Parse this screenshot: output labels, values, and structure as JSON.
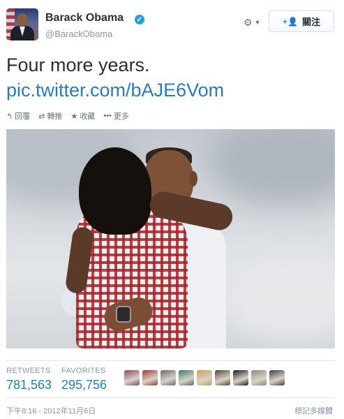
{
  "user": {
    "name": "Barack Obama",
    "handle": "@BarackObama",
    "verified_icon": "verified-check-icon"
  },
  "header": {
    "settings_icon": "gear-icon",
    "follow_button": {
      "icon": "add-user-icon",
      "label": "關注"
    }
  },
  "tweet": {
    "text": "Four more years.",
    "link": "pic.twitter.com/bAJE6Vom"
  },
  "actions": [
    {
      "icon": "reply-icon",
      "label": "回覆"
    },
    {
      "icon": "retweet-icon",
      "label": "轉推"
    },
    {
      "icon": "star-icon",
      "label": "收藏"
    },
    {
      "icon": "more-icon",
      "label": "更多"
    }
  ],
  "stats": {
    "retweets_label": "RETWEETS",
    "retweets_value": "781,563",
    "favorites_label": "FAVORITES",
    "favorites_value": "295,756"
  },
  "favoriters": {
    "count": 9,
    "colors": [
      "#8a4a6a",
      "#9a3b2e",
      "#6b6b6b",
      "#3f7a6a",
      "#c8a452",
      "#5a4530",
      "#1d1d1d",
      "#8d8a78",
      "#4a3d3a"
    ]
  },
  "footer": {
    "timestamp": "下午8:16 - 2012年11月6日",
    "flag_media": "標記多媒體"
  }
}
